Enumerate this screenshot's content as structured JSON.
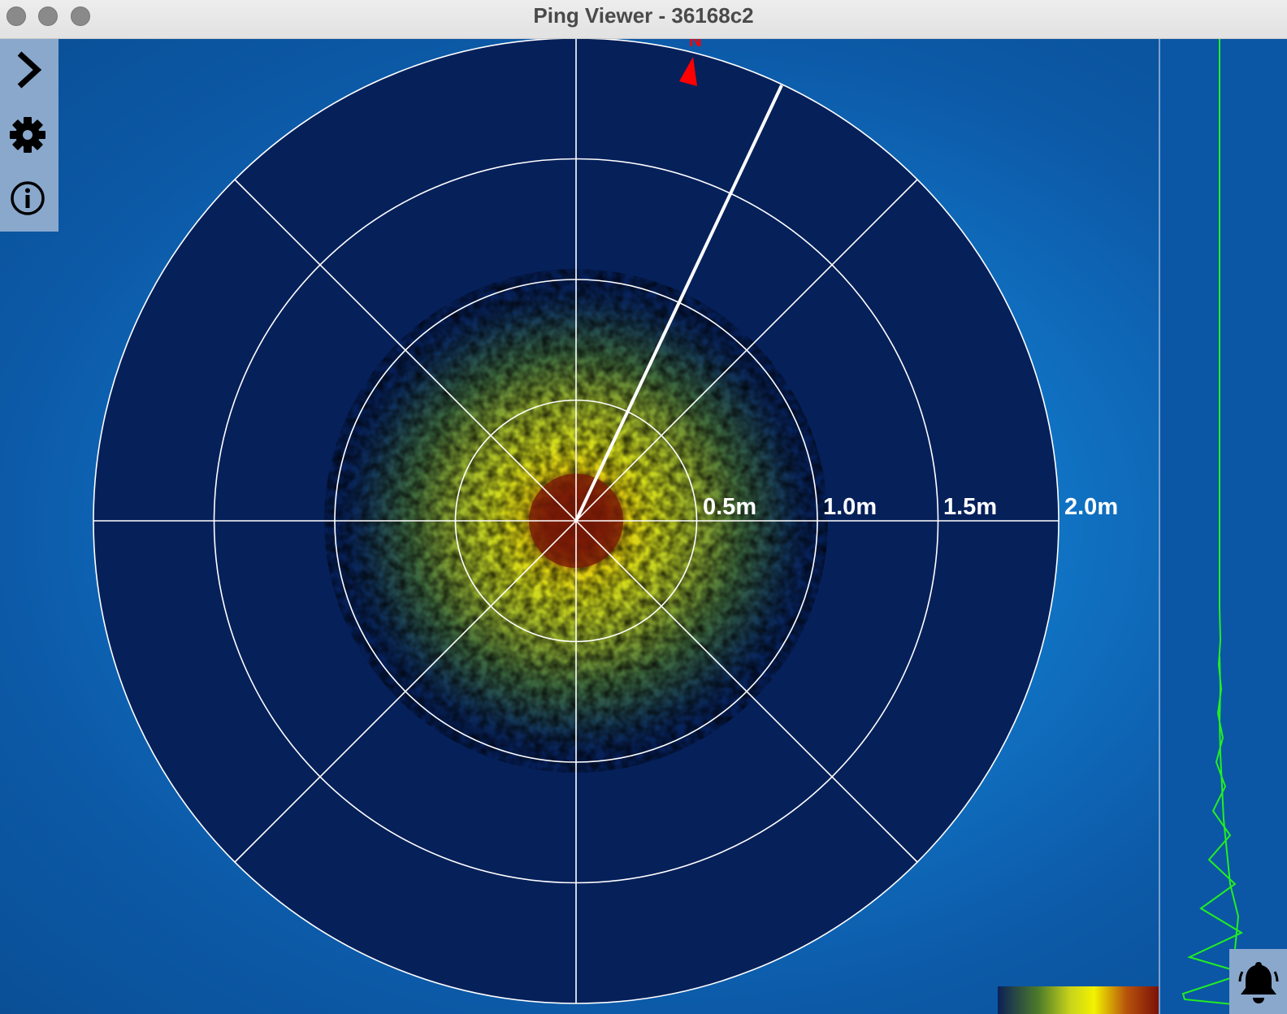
{
  "window": {
    "title": "Ping Viewer - 36168c2"
  },
  "toolbar": {
    "items": [
      {
        "name": "expand-menu",
        "icon": "chevron-right-icon"
      },
      {
        "name": "settings",
        "icon": "gear-icon"
      },
      {
        "name": "info",
        "icon": "info-icon"
      }
    ]
  },
  "sonar": {
    "range_labels": [
      "0.5m",
      "1.0m",
      "1.5m",
      "2.0m"
    ],
    "heading_marker_label": "N",
    "colors": {
      "background": "#06205a",
      "grid": "#ffffff",
      "heading": "#ff0000",
      "profile": "#22ee22"
    }
  },
  "profile_panel": {
    "alert_icon": "bell-icon"
  }
}
